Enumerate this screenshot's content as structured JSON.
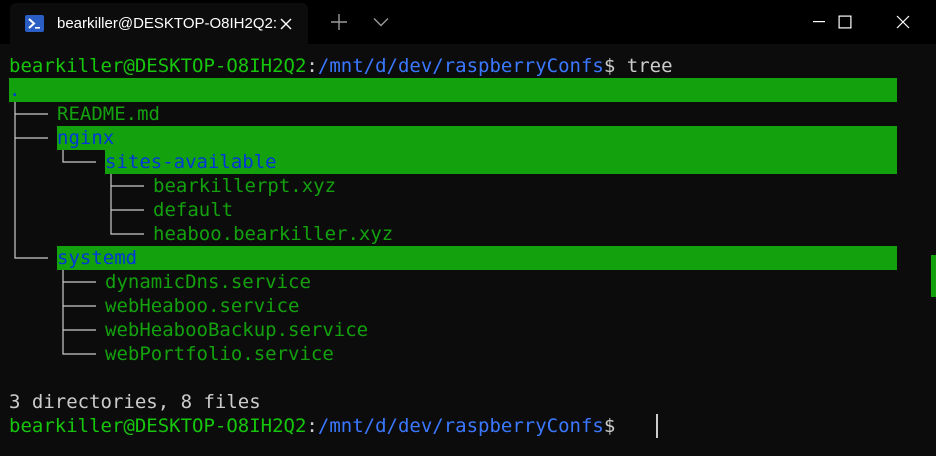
{
  "window": {
    "tab_title": "bearkiller@DESKTOP-O8IH2Q2:",
    "icons": {
      "tab": "powershell-icon",
      "close_tab": "close-icon",
      "new_tab": "plus-icon",
      "dropdown": "chevron-down-icon",
      "minimize": "minimize-icon",
      "maximize": "maximize-icon",
      "close_window": "close-icon"
    }
  },
  "terminal": {
    "prompt": {
      "user": "bearkiller@DESKTOP-O8IH2Q2",
      "sep": ":",
      "path": "/mnt/d/dev/raspberryConfs",
      "dollar": "$"
    },
    "command": " tree",
    "tree_root": ".",
    "entries": [
      {
        "name": "README.md",
        "type": "file"
      },
      {
        "name": "nginx",
        "type": "dir"
      },
      {
        "name": "sites-available",
        "type": "dir"
      },
      {
        "name": "bearkillerpt.xyz",
        "type": "file"
      },
      {
        "name": "default",
        "type": "file"
      },
      {
        "name": "heaboo.bearkiller.xyz",
        "type": "file"
      },
      {
        "name": "systemd",
        "type": "dir"
      },
      {
        "name": "dynamicDns.service",
        "type": "file"
      },
      {
        "name": "webHeaboo.service",
        "type": "file"
      },
      {
        "name": "webHeabooBackup.service",
        "type": "file"
      },
      {
        "name": "webPortfolio.service",
        "type": "file"
      }
    ],
    "summary": "3 directories, 8 files",
    "colors": {
      "background": "#0c0c0c",
      "highlight": "#13a10e",
      "user": "#16c60c",
      "path": "#3b78ff",
      "file": "#13a10e",
      "dir": "#0037da",
      "text": "#cccccc"
    }
  }
}
